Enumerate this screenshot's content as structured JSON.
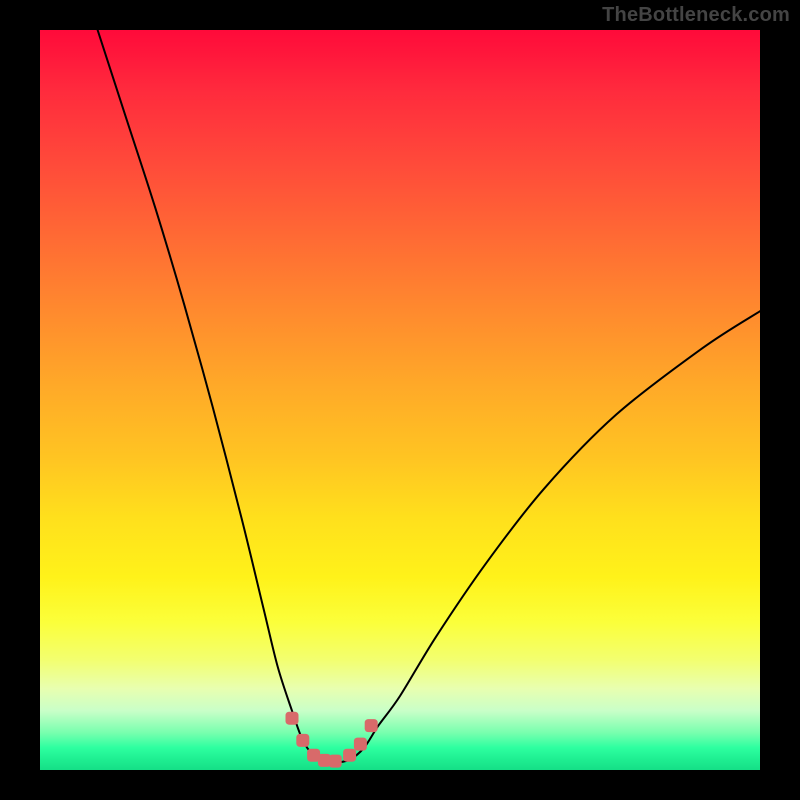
{
  "watermark": "TheBottleneck.com",
  "chart_data": {
    "type": "line",
    "title": "",
    "xlabel": "",
    "ylabel": "",
    "xlim": [
      0,
      100
    ],
    "ylim": [
      0,
      100
    ],
    "grid": false,
    "legend": "none",
    "series": [
      {
        "name": "bottleneck-curve",
        "x": [
          8,
          12,
          16,
          20,
          24,
          28,
          31,
          33,
          35,
          36.5,
          38,
          39.5,
          41,
          43,
          45,
          47,
          50,
          55,
          62,
          70,
          80,
          92,
          100
        ],
        "y": [
          100,
          88,
          76,
          63,
          49,
          34,
          22,
          14,
          8,
          4,
          2,
          1.2,
          1,
          1.4,
          3,
          6,
          10,
          18,
          28,
          38,
          48,
          57,
          62
        ]
      }
    ],
    "markers": {
      "name": "valley-markers",
      "x": [
        35,
        36.5,
        38,
        39.5,
        41,
        43,
        44.5,
        46
      ],
      "y": [
        7,
        4,
        2,
        1.3,
        1.2,
        2,
        3.5,
        6
      ]
    },
    "background_gradient": {
      "top": "#ff0a3a",
      "mid_upper": "#ff8a2e",
      "mid": "#fff21a",
      "mid_lower": "#e8ffb0",
      "bottom": "#15df87"
    }
  }
}
